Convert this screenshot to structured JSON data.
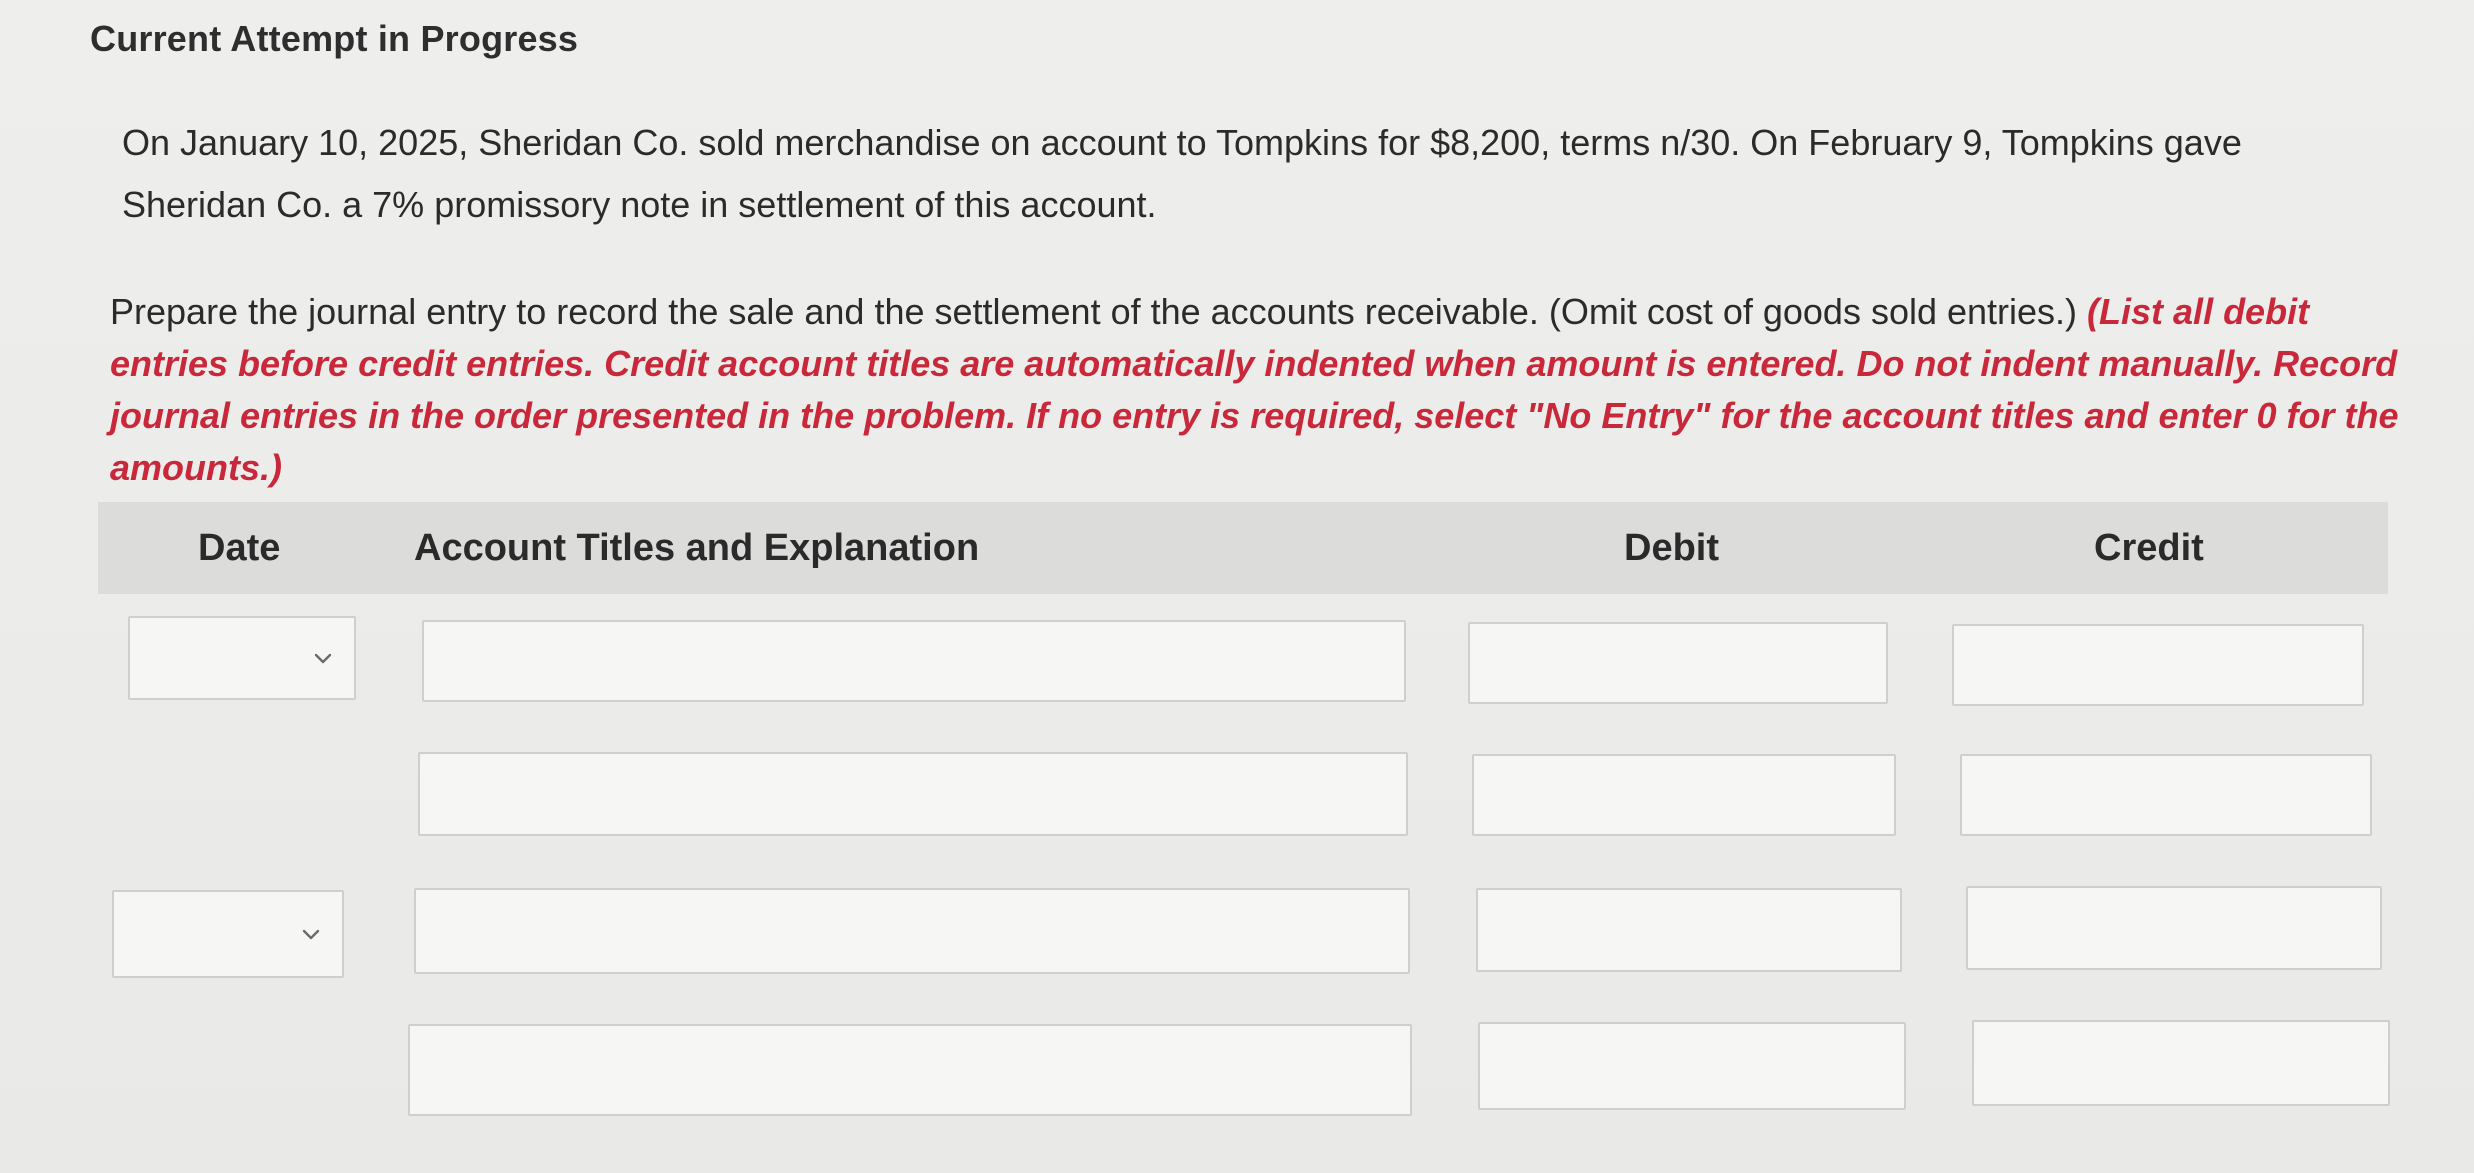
{
  "heading": "Current Attempt in Progress",
  "problem_text": "On January 10, 2025, Sheridan Co. sold merchandise on account to Tompkins for $8,200, terms n/30. On February 9, Tompkins gave Sheridan Co. a 7% promissory note in settlement of this account.",
  "instructions": {
    "main": "Prepare the journal entry to record the sale and the settlement of the accounts receivable. (Omit cost of goods sold entries.) ",
    "emphasis": "(List all debit entries before credit entries. Credit account titles are automatically indented when amount is entered. Do not indent manually. Record journal entries in the order presented in the problem. If no entry is required, select \"No Entry\" for the account titles and enter 0 for the amounts.)"
  },
  "table": {
    "columns": {
      "date": "Date",
      "account": "Account Titles and Explanation",
      "debit": "Debit",
      "credit": "Credit"
    },
    "rows": [
      {
        "date": "",
        "account": "",
        "debit": "",
        "credit": ""
      },
      {
        "account": "",
        "debit": "",
        "credit": ""
      },
      {
        "date": "",
        "account": "",
        "debit": "",
        "credit": ""
      },
      {
        "account": "",
        "debit": "",
        "credit": ""
      }
    ]
  },
  "icons": {
    "dropdown": "chevron-down-icon"
  },
  "colors": {
    "emphasis_red": "#c8283a",
    "header_bg": "#dcdcdb",
    "page_bg": "#ececea"
  }
}
